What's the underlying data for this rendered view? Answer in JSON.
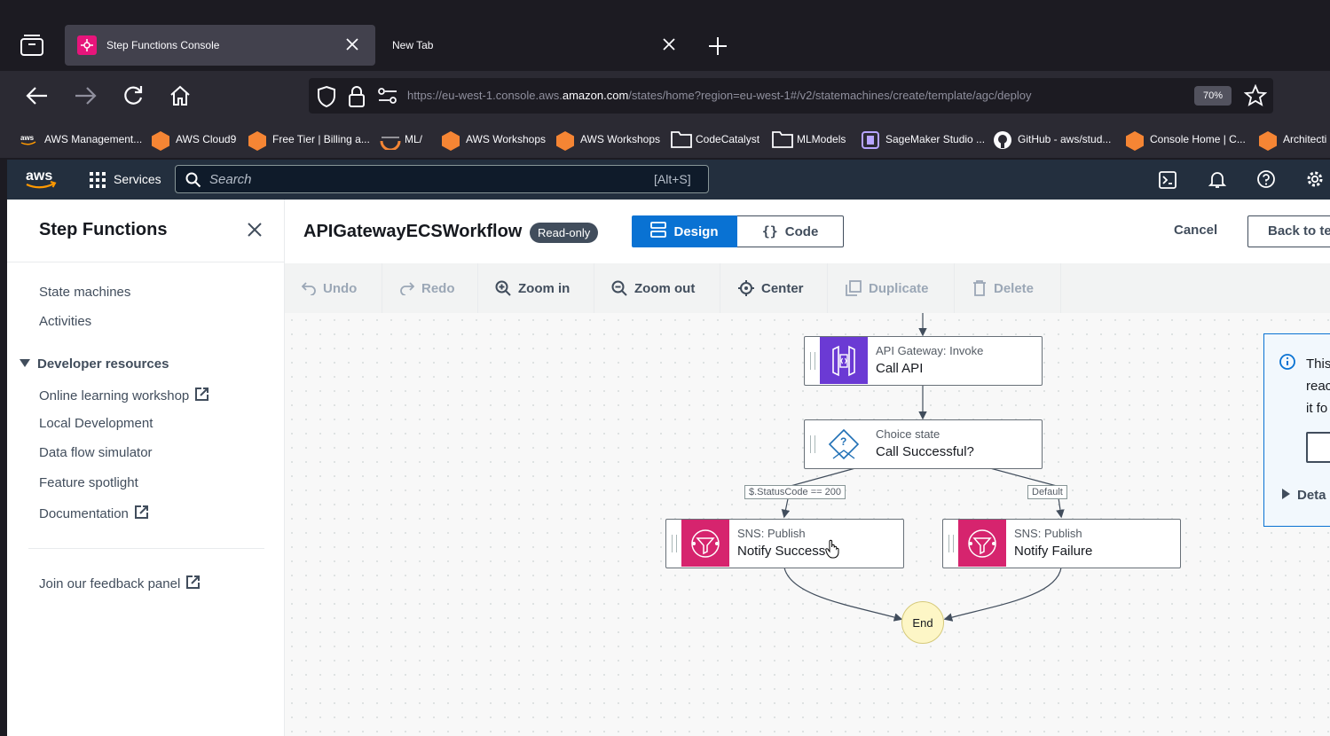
{
  "browser": {
    "tabs": [
      {
        "label": "Step Functions Console",
        "active": true
      },
      {
        "label": "New Tab",
        "active": false
      }
    ],
    "url": {
      "prefix": "https://eu-west-1.console.aws.",
      "domain": "amazon.com",
      "suffix": "/states/home?region=eu-west-1#/v2/statemachines/create/template/agc/deploy"
    },
    "zoom": "70%",
    "bookmarks": [
      {
        "label": "AWS Management...",
        "icon": "aws-icon"
      },
      {
        "label": "AWS Cloud9",
        "icon": "aws-cube-icon"
      },
      {
        "label": "Free Tier | Billing a...",
        "icon": "aws-cube-icon"
      },
      {
        "label": "ML/",
        "icon": "ml-icon"
      },
      {
        "label": "AWS Workshops",
        "icon": "aws-cube-icon"
      },
      {
        "label": "AWS Workshops",
        "icon": "aws-cube-icon"
      },
      {
        "label": "CodeCatalyst",
        "icon": "folder-icon"
      },
      {
        "label": "MLModels",
        "icon": "folder-icon"
      },
      {
        "label": "SageMaker Studio ...",
        "icon": "sagemaker-icon"
      },
      {
        "label": "GitHub - aws/stud...",
        "icon": "github-icon"
      },
      {
        "label": "Console Home | C...",
        "icon": "aws-cube-icon"
      },
      {
        "label": "Architecti",
        "icon": "aws-cube-icon"
      }
    ]
  },
  "aws_header": {
    "services_label": "Services",
    "search_placeholder": "Search",
    "search_shortcut": "[Alt+S]"
  },
  "sidebar": {
    "title": "Step Functions",
    "items": [
      {
        "label": "State machines"
      },
      {
        "label": "Activities"
      }
    ],
    "section_title": "Developer resources",
    "section_items": [
      {
        "label": "Online learning workshop",
        "external": true
      },
      {
        "label": "Local Development",
        "external": false
      },
      {
        "label": "Data flow simulator",
        "external": false
      },
      {
        "label": "Feature spotlight",
        "external": false
      },
      {
        "label": "Documentation",
        "external": true
      }
    ],
    "feedback_label": "Join our feedback panel"
  },
  "editor": {
    "workflow_name": "APIGatewayECSWorkflow",
    "badge": "Read-only",
    "tabs": [
      {
        "label": "Design",
        "active": true
      },
      {
        "label": "Code",
        "active": false
      }
    ],
    "cancel_label": "Cancel",
    "back_label": "Back to te",
    "toolbar": [
      {
        "label": "Undo",
        "icon": "undo-icon",
        "disabled": true
      },
      {
        "label": "Redo",
        "icon": "redo-icon",
        "disabled": true
      },
      {
        "label": "Zoom in",
        "icon": "zoom-in-icon",
        "disabled": false
      },
      {
        "label": "Zoom out",
        "icon": "zoom-out-icon",
        "disabled": false
      },
      {
        "label": "Center",
        "icon": "center-icon",
        "disabled": false
      },
      {
        "label": "Duplicate",
        "icon": "duplicate-icon",
        "disabled": true
      },
      {
        "label": "Delete",
        "icon": "delete-icon",
        "disabled": true
      }
    ]
  },
  "workflow": {
    "states": [
      {
        "type": "API Gateway: Invoke",
        "name": "Call API",
        "icon": "api-gateway-icon",
        "color": "#6b3ad4"
      },
      {
        "type": "Choice state",
        "name": "Call Successful?",
        "icon": "choice-icon",
        "color": "#1f6fb5"
      },
      {
        "type": "SNS: Publish",
        "name": "Notify Success",
        "icon": "sns-icon",
        "color": "#d6246e"
      },
      {
        "type": "SNS: Publish",
        "name": "Notify Failure",
        "icon": "sns-icon",
        "color": "#d6246e"
      }
    ],
    "edge_labels": [
      "$.StatusCode == 200",
      "Default"
    ],
    "end_label": "End"
  },
  "info_panel": {
    "lines": [
      "This",
      "reac",
      "it fo"
    ],
    "details_label": "Deta"
  }
}
